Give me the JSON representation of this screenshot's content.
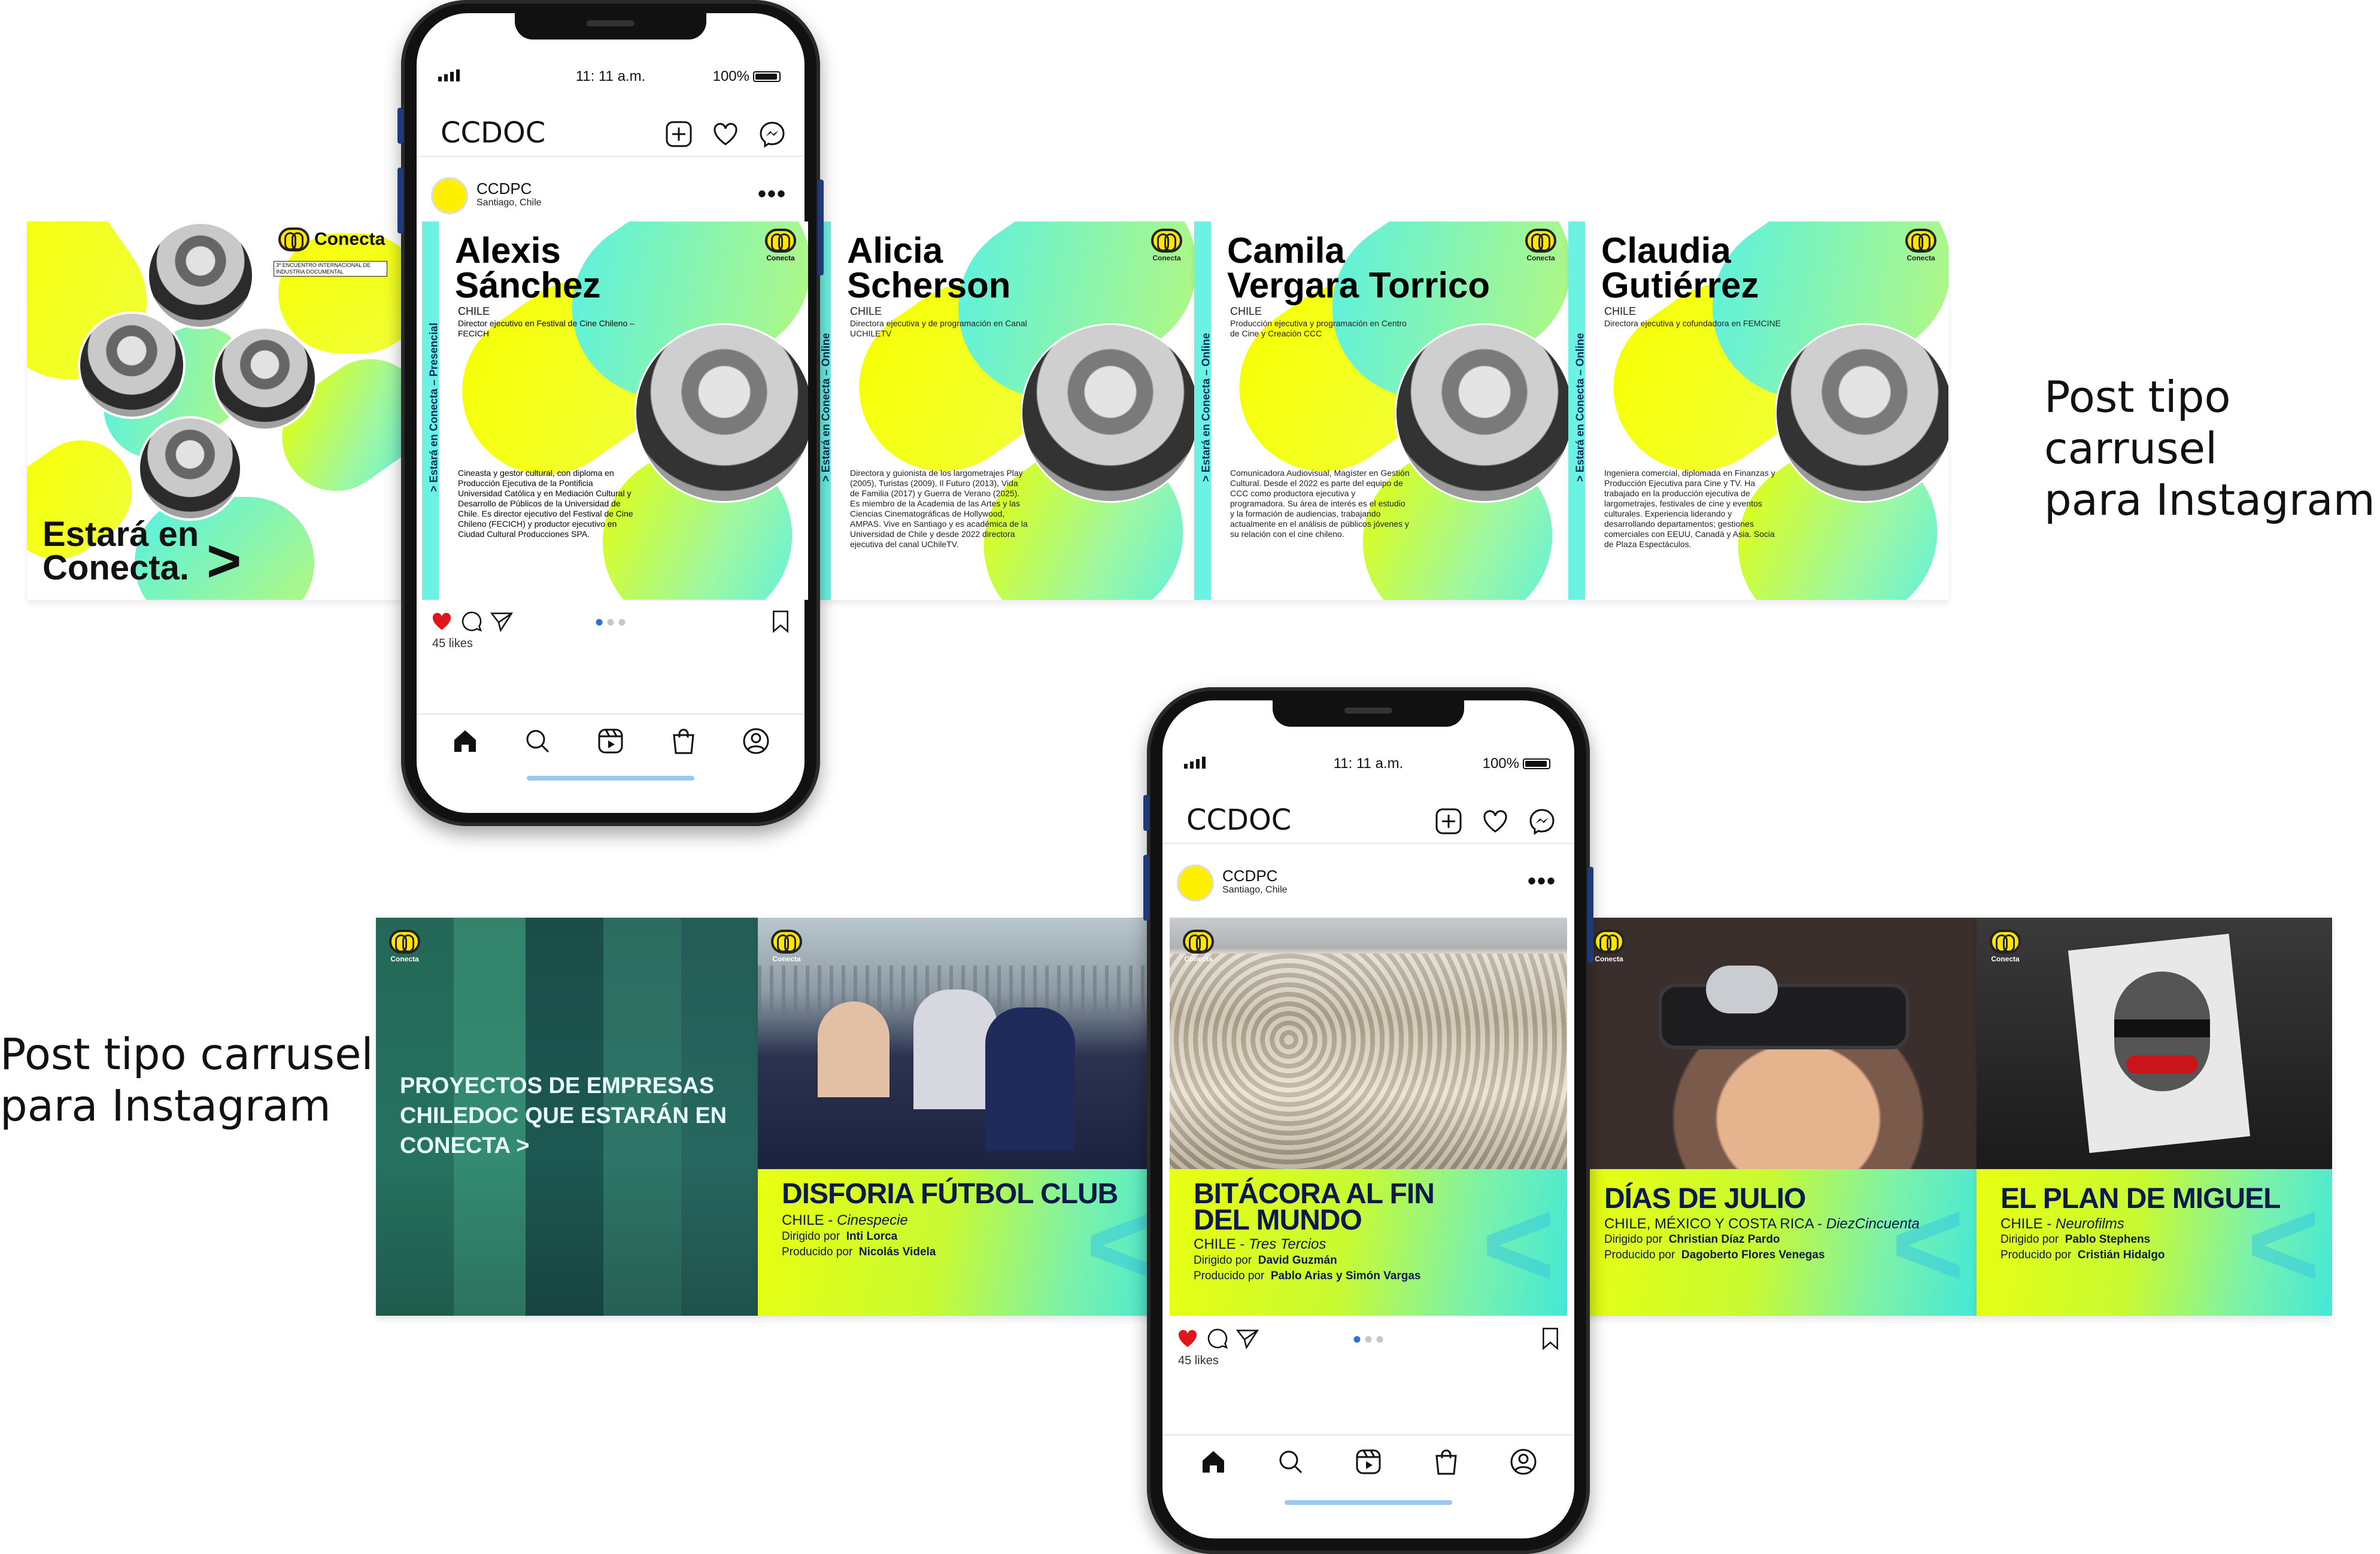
{
  "captions": {
    "right": "Post tipo carrusel\npara Instagram",
    "left": "Post tipo carrusel\npara Instagram"
  },
  "brand": {
    "logo_text": "Conecta",
    "logo_subtitle": "3º ENCUENTRO INTERNACIONAL DE INDUSTRIA DOCUMENTAL",
    "accent_yellow": "#f2ff00",
    "accent_cyan": "#4eeee0",
    "accent_blue": "#0b1a4a"
  },
  "cover": {
    "title": "Estará en\nConecta.",
    "arrow": ">"
  },
  "speakers": [
    {
      "name": "Alexis\nSánchez",
      "country": "CHILE",
      "role": "Director ejecutivo en Festival de Cine Chileno – FECICH",
      "bio": "Cineasta y gestor cultural, con diploma en Producción Ejecutiva de la Pontificia Universidad Católica y en Mediación Cultural y Desarrollo de Públicos de la Universidad de Chile. Es director ejecutivo del Festival de Cine Chileno (FECICH) y productor ejecutivo en Ciudad Cultural Producciones SPA.",
      "sidebar": "> Estará en Conecta – Presencial"
    },
    {
      "name": "Alicia\nScherson",
      "country": "CHILE",
      "role": "Directora ejecutiva y de programación en Canal UCHILETV",
      "bio": "Directora y guionista de los largometrajes Play (2005), Turistas (2009), Il Futuro (2013), Vida de Familia (2017) y Guerra de Verano (2025). Es miembro de la Academia de las Artes y las Ciencias Cinematográficas de Hollywood, AMPAS. Vive en Santiago y es académica de la Universidad de Chile y desde 2022 directora ejecutiva del canal UChileTV.",
      "sidebar": "> Estará en Conecta – Online"
    },
    {
      "name": "Camila\nVergara Torrico",
      "country": "CHILE",
      "role": "Producción ejecutiva y programación en Centro de Cine y Creación CCC",
      "bio": "Comunicadora Audiovisual, Magíster en Gestión Cultural. Desde el 2022 es parte del equipo de CCC como productora ejecutiva y programadora. Su área de interés es el estudio y la formación de audiencias, trabajando actualmente en el análisis de públicos jóvenes y su relación con el cine chileno.",
      "sidebar": "> Estará en Conecta – Online"
    },
    {
      "name": "Claudia\nGutiérrez",
      "country": "CHILE",
      "role": "Directora ejecutiva y cofundadora en FEMCINE",
      "bio": "Ingeniera comercial, diplomada en Finanzas y Producción Ejecutiva para Cine y TV. Ha trabajado en la producción ejecutiva de largometrajes, festivales de cine y eventos culturales. Experiencia liderando y desarrollando departamentos; gestiones comerciales con EEUU, Canadá y Asia. Socia de Plaza Espectáculos.",
      "sidebar": "> Estará en Conecta – Online"
    }
  ],
  "projects_cover": {
    "title": "PROYECTOS DE EMPRESAS CHILEDOC QUE ESTARÁN EN CONECTA >"
  },
  "films": [
    {
      "title": "DISFORIA FÚTBOL CLUB",
      "country": "CHILE",
      "company": "Cinespecie",
      "directed_label": "Dirigido por",
      "director": "Inti Lorca",
      "produced_label": "Producido por",
      "producer": "Nicolás Videla"
    },
    {
      "title": "BITÁCORA AL FIN\nDEL MUNDO",
      "country": "CHILE",
      "company": "Tres Tercios",
      "directed_label": "Dirigido por",
      "director": "David Guzmán",
      "produced_label": "Producido por",
      "producer": "Pablo Arias y Simón Vargas"
    },
    {
      "title": "DÍAS DE JULIO",
      "country": "CHILE, MÉXICO Y COSTA RICA",
      "company": "DiezCincuenta",
      "directed_label": "Dirigido por",
      "director": "Christian Díaz Pardo",
      "produced_label": "Producido por",
      "producer": "Dagoberto Flores Venegas"
    },
    {
      "title": "EL PLAN DE MIGUEL",
      "country": "CHILE",
      "company": "Neurofilms",
      "directed_label": "Dirigido por",
      "director": "Pablo Stephens",
      "produced_label": "Producido por",
      "producer": "Cristián Hidalgo"
    }
  ],
  "phone": {
    "time": "11: 11 a.m.",
    "battery": "100%",
    "app_name": "CCDOC",
    "account_name": "CCDPC",
    "account_location": "Santiago, Chile",
    "more_label": "•••",
    "likes": "45 likes"
  },
  "icons": {
    "status": [
      "signal-icon",
      "battery-icon"
    ],
    "appbar": [
      "new-post-icon",
      "heart-icon",
      "messenger-icon"
    ],
    "actions": [
      "like-icon",
      "comment-icon",
      "share-icon",
      "bookmark-icon"
    ],
    "nav": [
      "home-icon",
      "search-icon",
      "reels-icon",
      "shop-icon",
      "profile-icon"
    ]
  }
}
